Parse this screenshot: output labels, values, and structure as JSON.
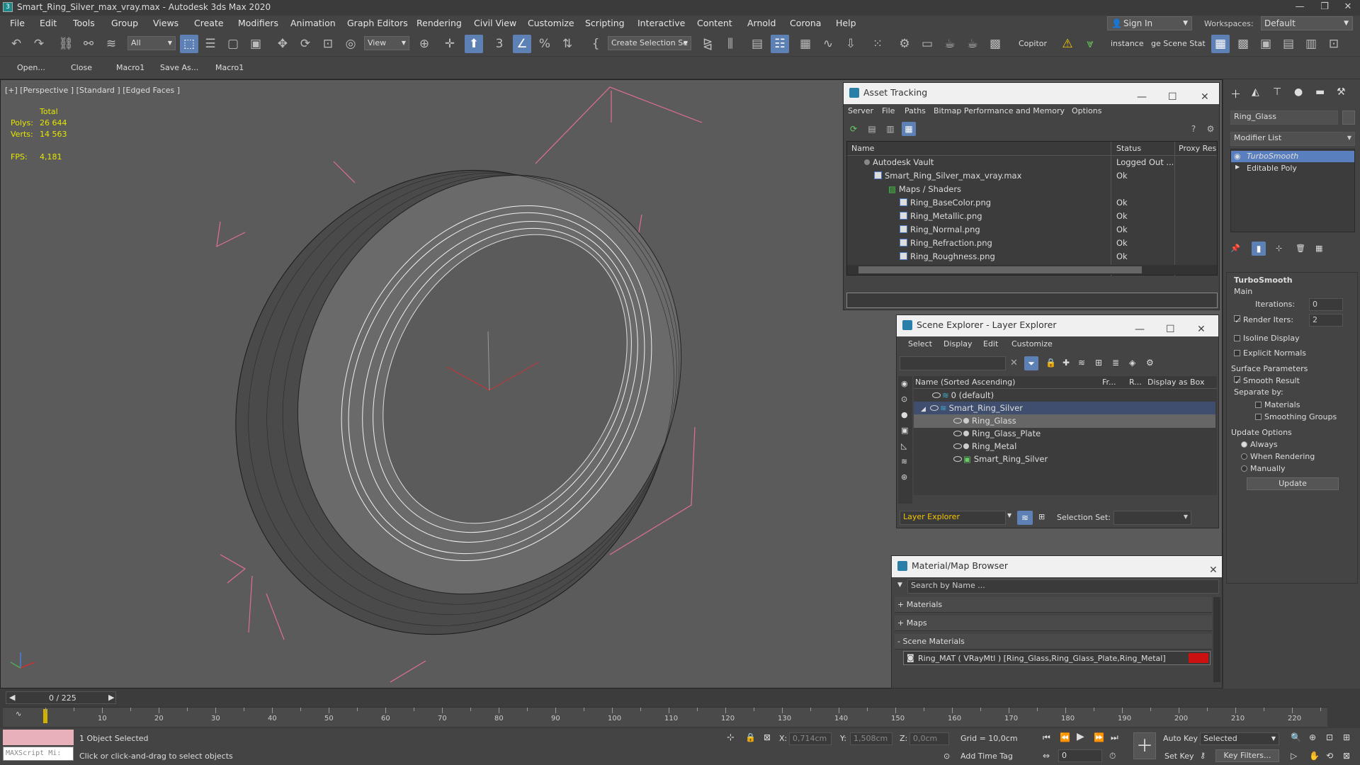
{
  "app": {
    "title": "Smart_Ring_Silver_max_vray.max - Autodesk 3ds Max 2020",
    "icon_text": "3"
  },
  "menu": [
    "File",
    "Edit",
    "Tools",
    "Group",
    "Views",
    "Create",
    "Modifiers",
    "Animation",
    "Graph Editors",
    "Rendering",
    "Civil View",
    "Customize",
    "Scripting",
    "Interactive",
    "Content",
    "Arnold",
    "Corona",
    "Help"
  ],
  "account": {
    "sign_in": "Sign In",
    "workspaces_label": "Workspaces:",
    "workspace": "Default"
  },
  "toolbar": {
    "selection_filter": "All",
    "ref_coord": "View",
    "selection_set": "Create Selection Se",
    "copitor": "Copitor",
    "instance": "instance",
    "scene_stat": "ge Scene Stat"
  },
  "toolbar2": [
    "Open...",
    "Close",
    "Macro1",
    "Save As...",
    "Macro1"
  ],
  "viewport": {
    "label": "[+] [Perspective ] [Standard ] [Edged Faces ]",
    "stats": {
      "total_label": "Total",
      "polys_label": "Polys:",
      "polys": "26 644",
      "verts_label": "Verts:",
      "verts": "14 563",
      "fps_label": "FPS:",
      "fps": "4,181"
    }
  },
  "asset_tracking": {
    "title": "Asset Tracking",
    "menu": [
      "Server",
      "File",
      "Paths",
      "Bitmap Performance and Memory",
      "Options"
    ],
    "columns": [
      "Name",
      "Status",
      "Proxy Res"
    ],
    "rows": [
      {
        "name": "Autodesk Vault",
        "status": "Logged Out ..."
      },
      {
        "name": "Smart_Ring_Silver_max_vray.max",
        "status": "Ok"
      },
      {
        "name": "Maps / Shaders",
        "status": ""
      },
      {
        "name": "Ring_BaseColor.png",
        "status": "Ok"
      },
      {
        "name": "Ring_Metallic.png",
        "status": "Ok"
      },
      {
        "name": "Ring_Normal.png",
        "status": "Ok"
      },
      {
        "name": "Ring_Refraction.png",
        "status": "Ok"
      },
      {
        "name": "Ring_Roughness.png",
        "status": "Ok"
      }
    ]
  },
  "scene_explorer": {
    "title": "Scene Explorer - Layer Explorer",
    "menu": [
      "Select",
      "Display",
      "Edit",
      "Customize"
    ],
    "columns": [
      "Name (Sorted Ascending)",
      "Fr...",
      "R...",
      "Display as Box"
    ],
    "rows": [
      {
        "name": "0 (default)"
      },
      {
        "name": "Smart_Ring_Silver"
      },
      {
        "name": "Ring_Glass"
      },
      {
        "name": "Ring_Glass_Plate"
      },
      {
        "name": "Ring_Metal"
      },
      {
        "name": "Smart_Ring_Silver"
      }
    ],
    "explorer_type": "Layer Explorer",
    "selection_set_label": "Selection Set:"
  },
  "material_browser": {
    "title": "Material/Map Browser",
    "search_placeholder": "Search by Name ...",
    "groups": [
      "+ Materials",
      "+ Maps",
      "- Scene Materials"
    ],
    "scene_material": "Ring_MAT  ( VRayMtl )  [Ring_Glass,Ring_Glass_Plate,Ring_Metal]",
    "swatch_color": "#cc1111"
  },
  "command_panel": {
    "object_name": "Ring_Glass",
    "modifier_list": "Modifier List",
    "stack": [
      "TurboSmooth",
      "Editable Poly"
    ],
    "rollout_title": "TurboSmooth",
    "main_label": "Main",
    "iterations_label": "Iterations:",
    "iterations": "0",
    "render_iters_label": "Render Iters:",
    "render_iters": "2",
    "isoline": "Isoline Display",
    "explicit_normals": "Explicit Normals",
    "surface_params": "Surface Parameters",
    "smooth_result": "Smooth Result",
    "separate_by": "Separate by:",
    "materials": "Materials",
    "smoothing_groups": "Smoothing Groups",
    "update_options": "Update Options",
    "always": "Always",
    "when_rendering": "When Rendering",
    "manually": "Manually",
    "update_button": "Update"
  },
  "timeline": {
    "frame": "0 / 225",
    "ticks": [
      "10",
      "20",
      "30",
      "40",
      "50",
      "60",
      "70",
      "80",
      "90",
      "100",
      "110",
      "120",
      "130",
      "140",
      "150",
      "160",
      "170",
      "180",
      "190",
      "200",
      "210",
      "220"
    ]
  },
  "status": {
    "maxscript": "MAXScript Mi:",
    "selected": "1 Object Selected",
    "prompt": "Click or click-and-drag to select objects",
    "x_label": "X:",
    "x": "0,714cm",
    "y_label": "Y:",
    "y": "1,508cm",
    "z_label": "Z:",
    "z": "0,0cm",
    "grid": "Grid = 10,0cm",
    "add_time_tag": "Add Time Tag",
    "auto_key": "Auto Key",
    "set_key": "Set Key",
    "selected_mode": "Selected",
    "key_filters": "Key Filters...",
    "frame_field": "0"
  }
}
